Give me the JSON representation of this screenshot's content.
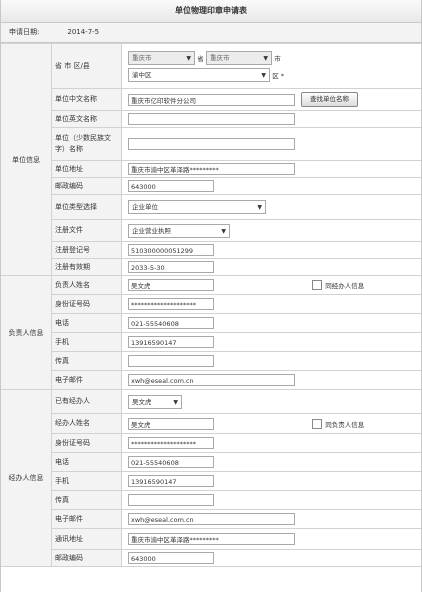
{
  "title": "单位物理印章申请表",
  "apply_date_label": "申请日期:",
  "apply_date": "2014-7-5",
  "unit": {
    "section_label": "单位信息",
    "region_label": "省 市 区/县",
    "province": "重庆市",
    "province_suffix": "省",
    "city": "重庆市",
    "city_suffix": "市",
    "district": "渝中区",
    "district_suffix": "区 *",
    "cn_name_label": "单位中文名称",
    "cn_name": "重庆市亿印软件分公司",
    "search_button": "查找单位名称",
    "en_name_label": "单位英文名称",
    "en_name": "",
    "minority_label": "单位（少数民族文字）名称",
    "minority_name": "",
    "address_label": "单位地址",
    "address": "重庆市渝中区革泽路*********",
    "postcode_label": "邮政编码",
    "postcode": "643000",
    "type_label": "单位类型选择",
    "type": "企业单位",
    "doc_label": "注册文件",
    "doc": "企业营业执照",
    "reg_no_label": "注册登记号",
    "reg_no": "510300000051299",
    "valid_label": "注册有效期",
    "valid": "2033-5-30"
  },
  "head": {
    "section_label": "负责人信息",
    "name_label": "负责人姓名",
    "name": "吴文虎",
    "same_label": "同经办人信息",
    "id_label": "身份证号码",
    "id": "********************",
    "phone_label": "电话",
    "phone": "021-55540608",
    "mobile_label": "手机",
    "mobile": "13916590147",
    "fax_label": "传真",
    "fax": "",
    "email_label": "电子邮件",
    "email": "xwh@eseal.com.cn"
  },
  "agent": {
    "section_label": "经办人信息",
    "existing_label": "已有经办人",
    "existing": "吴文虎",
    "name_label": "经办人姓名",
    "name": "吴文虎",
    "same_label": "同负责人信息",
    "id_label": "身份证号码",
    "id": "********************",
    "phone_label": "电话",
    "phone": "021-55540608",
    "mobile_label": "手机",
    "mobile": "13916590147",
    "fax_label": "传真",
    "fax": "",
    "email_label": "电子邮件",
    "email": "xwh@eseal.com.cn",
    "address_label": "通讯地址",
    "address": "重庆市渝中区革泽路*********",
    "postcode_label": "邮政编码",
    "postcode": "643000"
  },
  "icons": {
    "dropdown": "chevron-down-icon",
    "checkbox": "checkbox-icon"
  }
}
